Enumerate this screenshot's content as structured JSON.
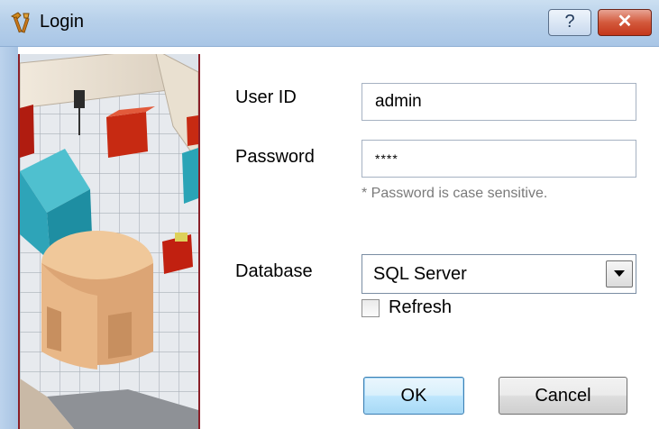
{
  "window": {
    "title": "Login",
    "help_symbol": "?",
    "close_symbol": "✕",
    "title_color": "#b7d0ea",
    "icon": "app-tools-icon"
  },
  "form": {
    "user_id_label": "User ID",
    "user_id_value": "admin",
    "password_label": "Password",
    "password_value": "****",
    "password_hint": "* Password is case sensitive.",
    "database_label": "Database",
    "database_value": "SQL Server",
    "refresh_label": "Refresh",
    "refresh_checked": false
  },
  "buttons": {
    "ok_label": "OK",
    "cancel_label": "Cancel"
  },
  "side_image": {
    "description_icon": "room-layout-image"
  }
}
